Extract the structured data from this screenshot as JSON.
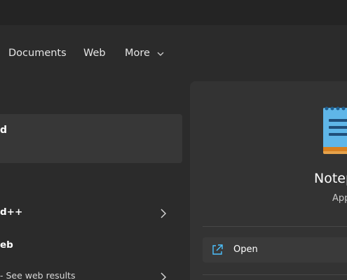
{
  "filters": {
    "tabs": [
      {
        "label": "Documents"
      },
      {
        "label": "Web"
      },
      {
        "label": "More"
      }
    ]
  },
  "results": {
    "best_match": {
      "label": "d"
    },
    "items": [
      {
        "label": "d++"
      },
      {
        "label": "eb"
      },
      {
        "label": "- See web results"
      }
    ]
  },
  "details": {
    "app_title": "Notep",
    "app_subtitle": "App",
    "actions": [
      {
        "label": "Open",
        "icon": "open-external-icon"
      }
    ]
  },
  "colors": {
    "background": "#2b2b2b",
    "panel": "#333333",
    "accent": "#4cc2ff"
  }
}
